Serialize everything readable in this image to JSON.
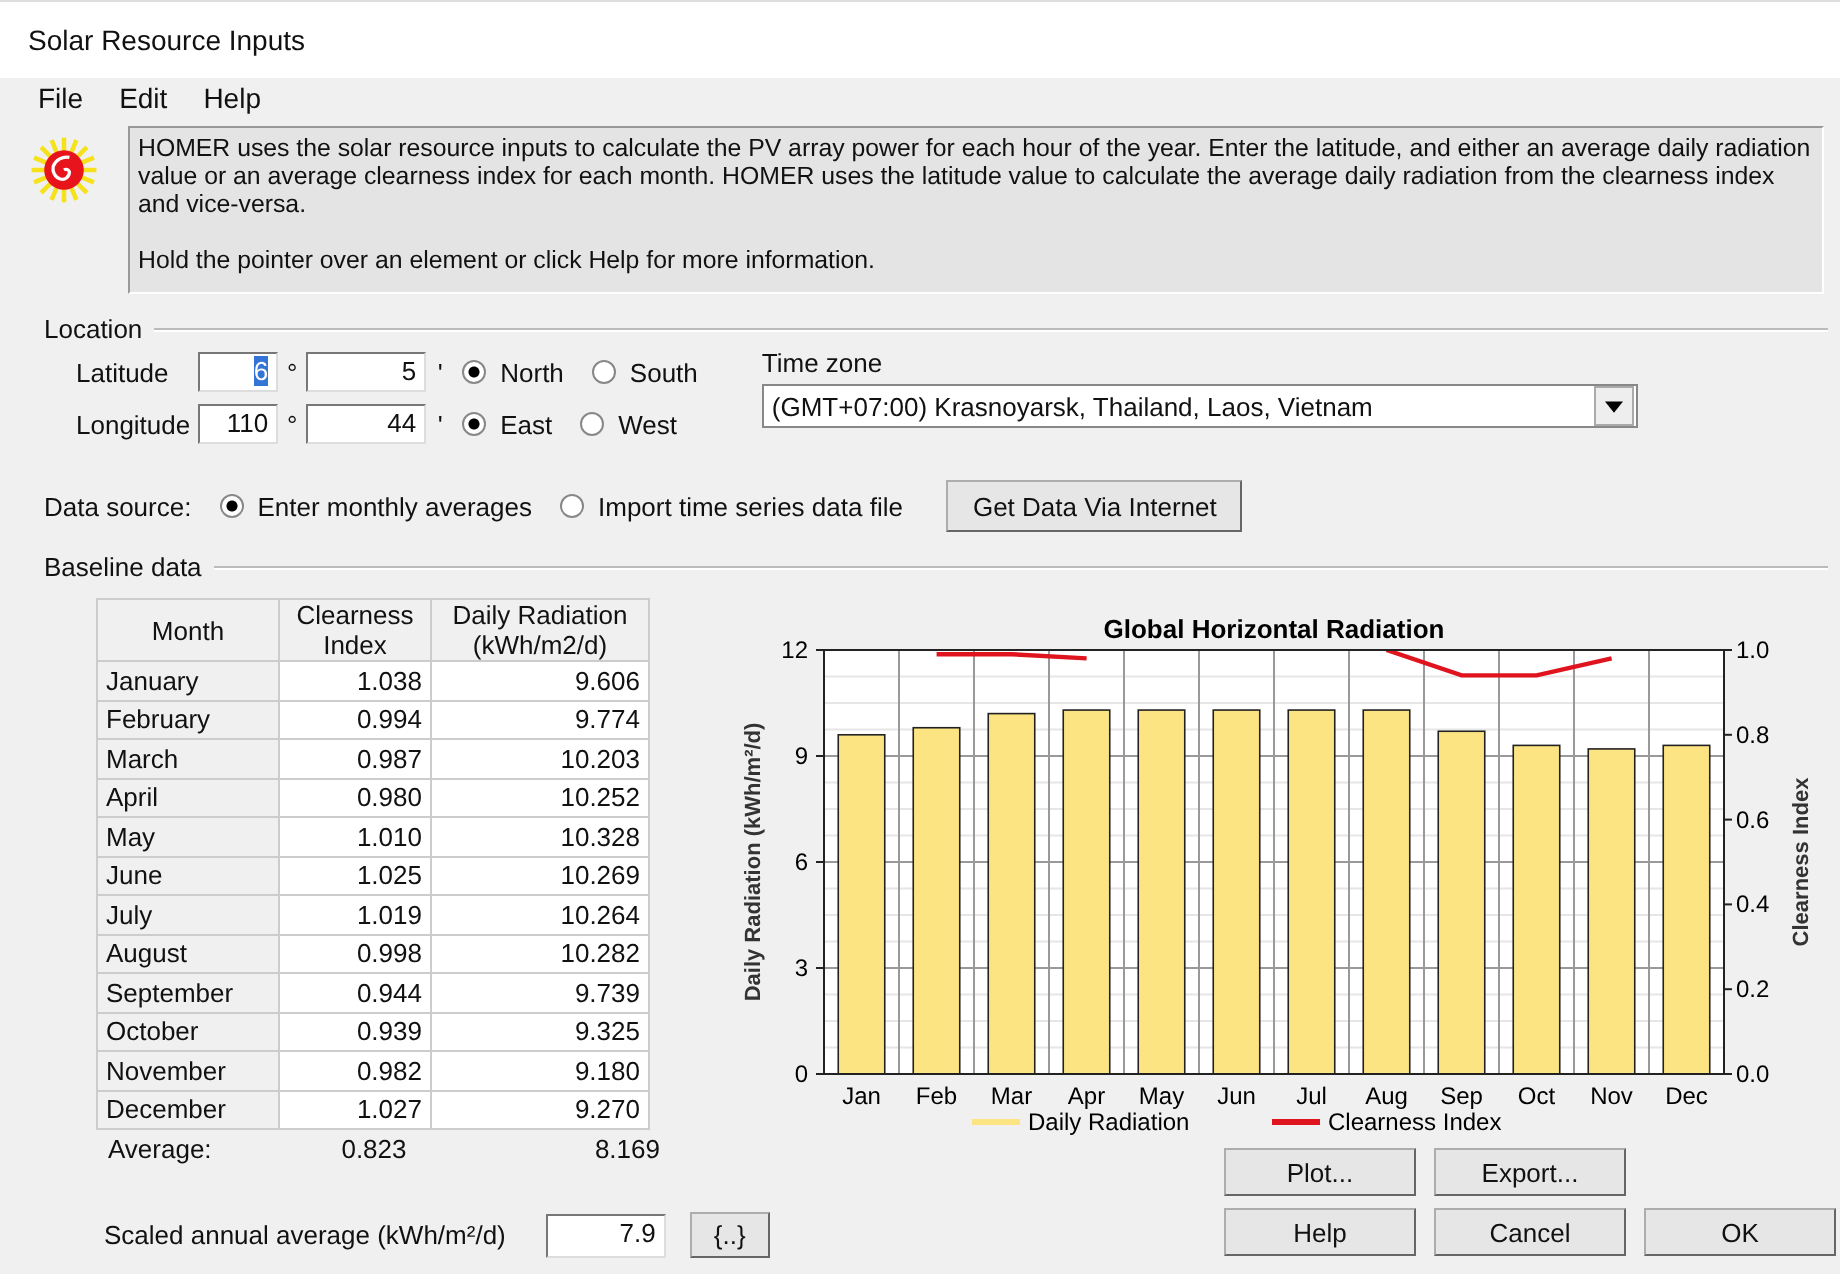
{
  "window": {
    "title": "Solar Resource Inputs"
  },
  "menu": [
    "File",
    "Edit",
    "Help"
  ],
  "info": {
    "paragraphs": [
      "HOMER uses the solar resource inputs to calculate the PV array power for each hour of the year. Enter the latitude, and either an average daily radiation value or an average clearness index for each month. HOMER uses the latitude value to calculate the average daily radiation from the clearness index and vice-versa.",
      "Hold the pointer over an element or click Help for more information."
    ]
  },
  "location": {
    "legend": "Location",
    "latitude": {
      "label": "Latitude",
      "degrees": "6",
      "minutes": "5",
      "options": [
        {
          "label": "North",
          "selected": true
        },
        {
          "label": "South",
          "selected": false
        }
      ]
    },
    "longitude": {
      "label": "Longitude",
      "degrees": "110",
      "minutes": "44",
      "options": [
        {
          "label": "East",
          "selected": true
        },
        {
          "label": "West",
          "selected": false
        }
      ]
    },
    "degree_mark": "°",
    "minute_mark": "'",
    "time_zone": {
      "label": "Time zone",
      "value": "(GMT+07:00) Krasnoyarsk, Thailand, Laos, Vietnam"
    }
  },
  "data_source": {
    "label": "Data source:",
    "options": [
      {
        "label": "Enter monthly averages",
        "selected": true
      },
      {
        "label": "Import time series data file",
        "selected": false
      }
    ],
    "button": "Get Data Via Internet"
  },
  "baseline": {
    "legend": "Baseline data",
    "table": {
      "columns": [
        "Month",
        "Clearness Index",
        "Daily Radiation (kWh/m2/d)"
      ],
      "rows": [
        [
          "January",
          "1.038",
          "9.606"
        ],
        [
          "February",
          "0.994",
          "9.774"
        ],
        [
          "March",
          "0.987",
          "10.203"
        ],
        [
          "April",
          "0.980",
          "10.252"
        ],
        [
          "May",
          "1.010",
          "10.328"
        ],
        [
          "June",
          "1.025",
          "10.269"
        ],
        [
          "July",
          "1.019",
          "10.264"
        ],
        [
          "August",
          "0.998",
          "10.282"
        ],
        [
          "September",
          "0.944",
          "9.739"
        ],
        [
          "October",
          "0.939",
          "9.325"
        ],
        [
          "November",
          "0.982",
          "9.180"
        ],
        [
          "December",
          "1.027",
          "9.270"
        ]
      ],
      "average": [
        "Average:",
        "0.823",
        "8.169"
      ]
    },
    "chart_data": {
      "type": "bar",
      "grid": true,
      "title": "Global Horizontal Radiation",
      "ylabel": "Daily Radiation (kWh/m²/d)",
      "y2label": "Clearness Index",
      "categories": [
        "Jan",
        "Feb",
        "Mar",
        "Apr",
        "May",
        "Jun",
        "Jul",
        "Aug",
        "Sep",
        "Oct",
        "Nov",
        "Dec"
      ],
      "series": [
        {
          "name": "Daily Radiation",
          "color": "#fde483",
          "values": [
            9.6,
            9.8,
            10.2,
            10.3,
            10.3,
            10.3,
            10.3,
            10.3,
            9.7,
            9.3,
            9.2,
            9.3
          ]
        },
        {
          "name": "Clearness Index",
          "type": "line",
          "axis": "y2",
          "color": "#e0141e",
          "values": [
            null,
            0.99,
            0.99,
            0.98,
            null,
            null,
            null,
            1.0,
            0.94,
            0.94,
            0.98,
            null
          ]
        }
      ],
      "ylim": [
        0,
        12
      ],
      "yticks": [
        0,
        3,
        6,
        9,
        12
      ],
      "y2lim": [
        0,
        1
      ],
      "y2ticks": [
        {
          "value": 0,
          "label": "0.0"
        },
        {
          "value": 0.2,
          "label": "0.2"
        },
        {
          "value": 0.4,
          "label": "0.4"
        },
        {
          "value": 0.6,
          "label": "0.6"
        },
        {
          "value": 0.8,
          "label": "0.8"
        },
        {
          "value": 1,
          "label": "1.0"
        }
      ]
    },
    "scaled": {
      "label": "Scaled annual average (kWh/m²/d)",
      "value": "7.9",
      "button": "{..}"
    }
  },
  "buttons": {
    "top": [
      "Plot...",
      "Export..."
    ],
    "bottom": [
      "Help",
      "Cancel",
      "OK"
    ]
  }
}
